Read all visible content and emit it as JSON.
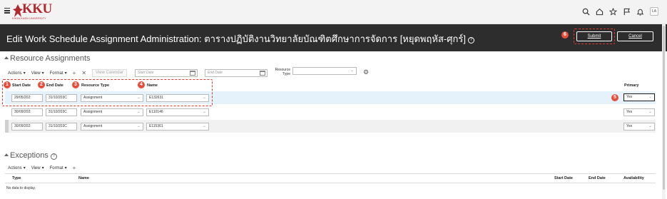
{
  "header": {
    "logo_text": "KKU",
    "university": "KHON KAEN UNIVERSITY",
    "icons": [
      "search-icon",
      "home-icon",
      "star-icon",
      "flag-icon",
      "bell-icon"
    ],
    "user_initials": "LA"
  },
  "page": {
    "title": "Edit Work Schedule Assignment Administration: ตารางปฏิบัติงานวิทยาลัยบัณฑิตศึกษาการจัดการ [หยุดพฤหัส-ศุกร์]",
    "help_glyph": "?",
    "submit_label": "Submit",
    "cancel_label": "Cancel"
  },
  "markers": [
    "1",
    "2",
    "3",
    "4",
    "5",
    "6"
  ],
  "resource_assignments": {
    "title": "Resource Assignments",
    "toolbar": {
      "actions": "Actions",
      "view": "View",
      "format": "Format",
      "view_calendar": "View Calendar",
      "start_date_placeholder": "Start Date",
      "end_date_placeholder": "End Date",
      "resource_type_label": "Resource Type"
    },
    "columns": {
      "start_date": "Start Date",
      "end_date": "End Date",
      "resource_type": "Resource Type",
      "name": "Name",
      "primary": "Primary"
    },
    "rows": [
      {
        "start": "29/05/202:",
        "end": "31/10/203C",
        "type": "Assignment",
        "name": "E132631",
        "primary": "Yes"
      },
      {
        "start": "30/09/202:",
        "end": "31/10/203C",
        "type": "Assignment",
        "name": "E110146",
        "primary": "Yes"
      },
      {
        "start": "30/09/202:",
        "end": "31/10/203C",
        "type": "Assignment",
        "name": "E115361",
        "primary": "Yes"
      }
    ]
  },
  "exceptions": {
    "title": "Exceptions",
    "toolbar": {
      "actions": "Actions",
      "view": "View",
      "format": "Format"
    },
    "columns": {
      "type": "Type",
      "name": "Name",
      "start_date": "Start Date",
      "end_date": "End Date",
      "availability": "Availability"
    },
    "empty_text": "No data to display."
  },
  "colors": {
    "brand": "#b3262b",
    "title_band": "#2d2d2d",
    "marker": "#e64e3a",
    "selected_row": "#e5f2fb"
  }
}
